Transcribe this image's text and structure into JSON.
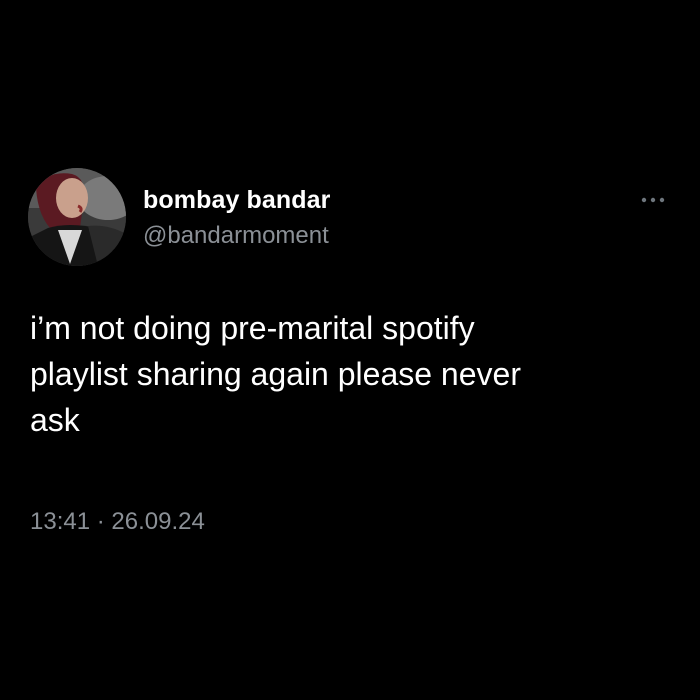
{
  "author": {
    "display_name": "bombay bandar",
    "handle": "@bandarmoment",
    "avatar_icon": "profile-photo"
  },
  "menu": {
    "icon": "more-horizontal-icon"
  },
  "tweet": {
    "text": "i’m not doing pre-marital spotify\nplaylist sharing again please never\nask",
    "time": "13:41",
    "separator": "·",
    "date": "26.09.24"
  },
  "colors": {
    "background": "#000000",
    "primary_text": "#ffffff",
    "secondary_text": "#8b9096"
  }
}
